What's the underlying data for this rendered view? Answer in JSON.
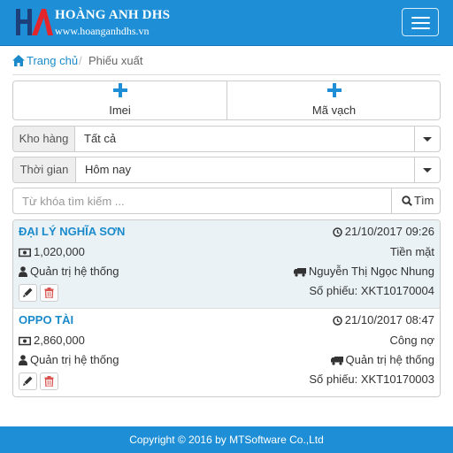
{
  "header": {
    "brand_name": "HOÀNG ANH DHS",
    "brand_site": "www.hoanganhdhs.vn",
    "logo_text": "HA"
  },
  "breadcrumb": {
    "home": "Trang chủ",
    "separator": "/",
    "current": "Phiếu xuất"
  },
  "scan_buttons": [
    {
      "label": "Imei",
      "icon": "plus-icon"
    },
    {
      "label": "Mã vạch",
      "icon": "plus-icon"
    }
  ],
  "filters": {
    "warehouse": {
      "label": "Kho hàng",
      "value": "Tất cả"
    },
    "time": {
      "label": "Thời gian",
      "value": "Hôm nay"
    }
  },
  "search": {
    "placeholder": "Từ khóa tìm kiếm ...",
    "button_label": "Tìm"
  },
  "slips": [
    {
      "customer": "ĐẠI LÝ NGHĨA SƠN",
      "datetime": "21/10/2017 09:26",
      "amount": "1,020,000",
      "payment": "Tiền mặt",
      "creator": "Quản trị hệ thống",
      "shipper": "Nguyễn Thị Ngọc Nhung",
      "slip_no": "Số phiếu: XKT10170004"
    },
    {
      "customer": "OPPO TÀI",
      "datetime": "21/10/2017 08:47",
      "amount": "2,860,000",
      "payment": "Công nợ",
      "creator": "Quản trị hệ thống",
      "shipper": "Quản trị hệ thống",
      "slip_no": "Số phiếu: XKT10170003"
    }
  ],
  "footer": {
    "text": "Copyright © 2016 by MTSoftware Co.,Ltd"
  },
  "colors": {
    "primary": "#1e8fd6",
    "link": "#1a8acb",
    "delete": "#d9534f",
    "logo_red": "#e3262b"
  }
}
